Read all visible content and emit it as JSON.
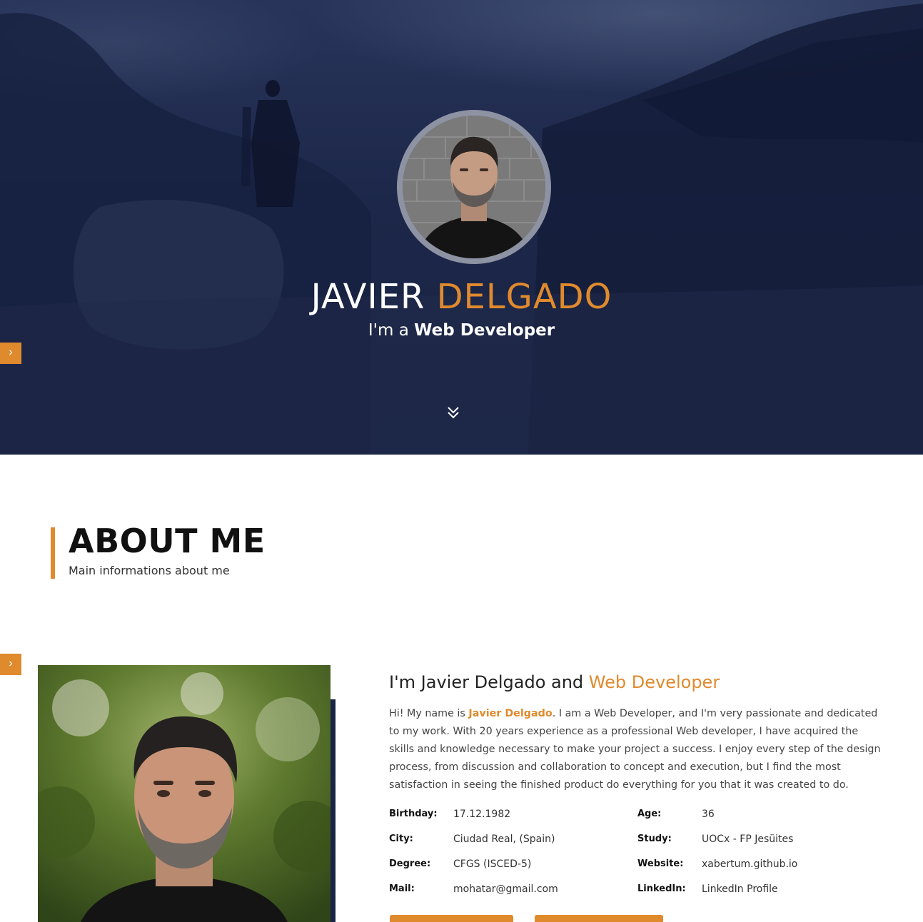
{
  "hero": {
    "first_name": "JAVIER",
    "last_name": "DELGADO",
    "subtitle_prefix": "I'm a",
    "subtitle_role": "Web Developer",
    "side_tab_icon": "chevron-right-icon",
    "scroll_icon": "double-chevron-down-icon"
  },
  "about": {
    "title": "ABOUT ME",
    "subtitle": "Main informations about me",
    "heading_prefix": "I'm Javier Delgado and",
    "heading_role": "Web Developer",
    "bio_before": "Hi! My name is",
    "bio_name": "Javier Delgado",
    "bio_after": ". I am a Web Developer, and I'm very passionate and dedicated to my work. With 20 years experience as a professional Web developer, I have acquired the skills and knowledge necessary to make your project a success. I enjoy every step of the design process, from discussion and collaboration to concept and execution, but I find the most satisfaction in seeing the finished product do everything for you that it was created to do.",
    "details": {
      "birthday": {
        "label": "Birthday:",
        "value": "17.12.1982"
      },
      "age": {
        "label": "Age:",
        "value": "36"
      },
      "city": {
        "label": "City:",
        "value": "Ciudad Real, (Spain)"
      },
      "study": {
        "label": "Study:",
        "value": "UOCx - FP Jesüites"
      },
      "degree": {
        "label": "Degree:",
        "value": "CFGS (ISCED-5)"
      },
      "website": {
        "label": "Website:",
        "value": "xabertum.github.io"
      },
      "mail": {
        "label": "Mail:",
        "value": "mohatar@gmail.com"
      },
      "linkedin": {
        "label": "LinkedIn:",
        "value": "LinkedIn Profile"
      }
    }
  },
  "colors": {
    "accent": "#e08a2e",
    "navy": "#1a2444"
  }
}
